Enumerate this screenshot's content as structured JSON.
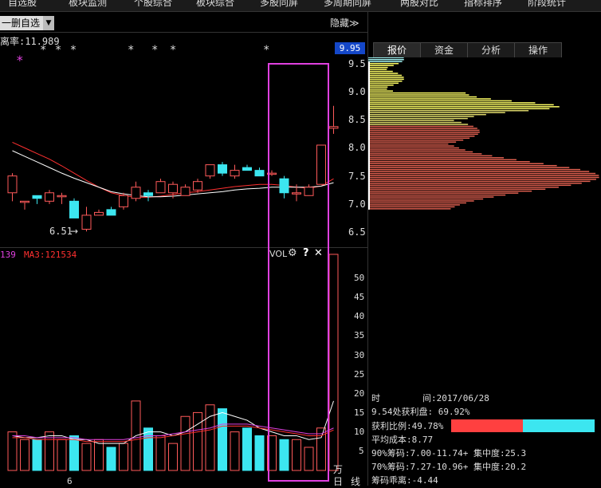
{
  "top_menu": [
    "自选股",
    "板块监测",
    "个股综合",
    "板块综合",
    "多股同屏",
    "多周期同屏",
    "两股对比",
    "指标排序",
    "阶段统计"
  ],
  "selector": {
    "label": "一删自选",
    "arrow": "▼"
  },
  "hide_button": "隐藏≫",
  "indicator_line": "离率:11.989",
  "price_tag": "9.95",
  "price_axis": [
    "9.5",
    "9.0",
    "8.5",
    "8.0",
    "7.5",
    "7.0",
    "6.5"
  ],
  "low_label": "6.51",
  "vol_header": {
    "left_value": "139",
    "ma3": "MA3:121534"
  },
  "vol_tool": {
    "name": "VOL",
    "gear": "⚙",
    "help": "?",
    "close": "✕"
  },
  "vol_axis": [
    "50",
    "45",
    "40",
    "35",
    "30",
    "25",
    "20",
    "15",
    "10",
    "5"
  ],
  "vol_unit": "万",
  "bottom_date": "6",
  "bottom_tabs": [
    "日",
    "线"
  ],
  "right_tabs": [
    "报价",
    "资金",
    "分析",
    "操作"
  ],
  "chip_info": {
    "time_label": "时",
    "time_value": "间:2017/06/28",
    "profit_line": "9.54处获利盘: 69.92%",
    "profit_ratio": "获利比例:49.78%",
    "avg_cost": "平均成本:8.77",
    "chip90": "90%筹码:7.00-11.74+ 集中度:25.3",
    "chip70": "70%筹码:7.27-10.96+ 集中度:20.2",
    "divergence": "筹码乖离:-4.44"
  },
  "profit_ratio_value": 0.4978,
  "colors": {
    "up": "#ff5a5a",
    "down": "#3ce6f0",
    "ma5": "#ffffff",
    "ma10": "#ff3030",
    "highlight": "#e040e0",
    "chip_profit": "#ffff66",
    "chip_loss": "#e06050"
  },
  "stars": [
    "* * *",
    "*",
    "* *",
    "*"
  ],
  "stars_pink": "*",
  "candles": [
    {
      "o": 7.2,
      "h": 7.55,
      "l": 7.05,
      "c": 7.5
    },
    {
      "o": 7.05,
      "h": 7.05,
      "l": 6.9,
      "c": 7.05
    },
    {
      "o": 7.15,
      "h": 7.15,
      "l": 7.0,
      "c": 7.1
    },
    {
      "o": 7.05,
      "h": 7.25,
      "l": 7.0,
      "c": 7.2
    },
    {
      "o": 7.15,
      "h": 7.2,
      "l": 7.0,
      "c": 7.15
    },
    {
      "o": 7.05,
      "h": 7.1,
      "l": 6.75,
      "c": 6.75
    },
    {
      "o": 6.55,
      "h": 6.95,
      "l": 6.51,
      "c": 6.8
    },
    {
      "o": 6.8,
      "h": 6.9,
      "l": 6.8,
      "c": 6.85
    },
    {
      "o": 6.9,
      "h": 6.95,
      "l": 6.8,
      "c": 6.8
    },
    {
      "o": 6.95,
      "h": 7.2,
      "l": 6.9,
      "c": 7.15
    },
    {
      "o": 7.1,
      "h": 7.4,
      "l": 7.05,
      "c": 7.3
    },
    {
      "o": 7.2,
      "h": 7.25,
      "l": 7.05,
      "c": 7.15
    },
    {
      "o": 7.2,
      "h": 7.45,
      "l": 7.2,
      "c": 7.4
    },
    {
      "o": 7.2,
      "h": 7.4,
      "l": 7.1,
      "c": 7.35
    },
    {
      "o": 7.15,
      "h": 7.35,
      "l": 7.15,
      "c": 7.3
    },
    {
      "o": 7.25,
      "h": 7.45,
      "l": 7.2,
      "c": 7.4
    },
    {
      "o": 7.5,
      "h": 7.7,
      "l": 7.45,
      "c": 7.7
    },
    {
      "o": 7.7,
      "h": 7.75,
      "l": 7.5,
      "c": 7.55
    },
    {
      "o": 7.5,
      "h": 7.7,
      "l": 7.45,
      "c": 7.6
    },
    {
      "o": 7.65,
      "h": 7.7,
      "l": 7.6,
      "c": 7.6
    },
    {
      "o": 7.6,
      "h": 7.65,
      "l": 7.5,
      "c": 7.5
    },
    {
      "o": 7.55,
      "h": 7.6,
      "l": 7.5,
      "c": 7.55
    },
    {
      "o": 7.45,
      "h": 7.5,
      "l": 7.1,
      "c": 7.2
    },
    {
      "o": 7.2,
      "h": 7.35,
      "l": 7.05,
      "c": 7.2
    },
    {
      "o": 7.15,
      "h": 7.35,
      "l": 7.15,
      "c": 7.3
    },
    {
      "o": 7.35,
      "h": 8.05,
      "l": 7.35,
      "c": 8.05
    },
    {
      "o": 8.35,
      "h": 8.75,
      "l": 8.25,
      "c": 8.38
    }
  ],
  "volumes": [
    10,
    8,
    8,
    10,
    8,
    9,
    7,
    8,
    6,
    7,
    18,
    11,
    9,
    7,
    14,
    15,
    17,
    16,
    10,
    11,
    9,
    9,
    8,
    8,
    6,
    11,
    56
  ],
  "vol_ma": [
    9,
    8.5,
    8.5,
    9,
    9,
    8,
    8,
    7,
    7,
    7,
    9,
    10,
    10,
    9,
    10,
    12,
    14,
    15,
    14,
    13,
    11,
    10,
    9,
    9,
    8,
    8.5,
    18
  ],
  "vol_ma2": [
    9,
    9,
    8.5,
    8.5,
    8.5,
    8.5,
    8,
    8,
    8,
    8,
    8.5,
    9,
    9,
    9.5,
    10,
    10.5,
    11,
    12,
    12,
    12,
    11.5,
    11,
    10.5,
    10,
    9.5,
    9.5,
    11
  ],
  "ma_short": [
    8.1,
    8.0,
    7.9,
    7.8,
    7.68,
    7.55,
    7.42,
    7.3,
    7.2,
    7.15,
    7.12,
    7.12,
    7.14,
    7.17,
    7.2,
    7.22,
    7.25,
    7.28,
    7.31,
    7.33,
    7.35,
    7.35,
    7.33,
    7.3,
    7.28,
    7.32,
    7.45
  ],
  "ma_long": [
    7.95,
    7.85,
    7.75,
    7.65,
    7.55,
    7.46,
    7.38,
    7.3,
    7.22,
    7.18,
    7.15,
    7.13,
    7.13,
    7.14,
    7.16,
    7.18,
    7.2,
    7.22,
    7.25,
    7.27,
    7.28,
    7.3,
    7.3,
    7.3,
    7.3,
    7.32,
    7.38
  ]
}
